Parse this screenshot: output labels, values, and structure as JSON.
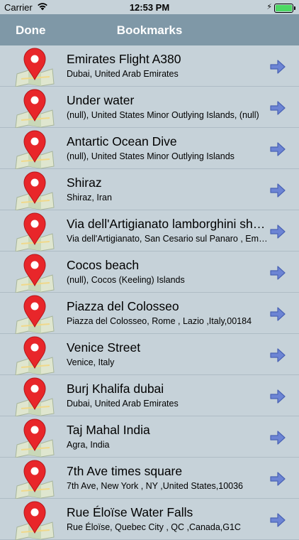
{
  "status_bar": {
    "carrier": "Carrier",
    "time": "12:53 PM",
    "wifi_icon": "wifi-icon",
    "battery_icon": "battery-icon",
    "charging_icon": "charging-bolt-icon"
  },
  "nav": {
    "done_label": "Done",
    "title": "Bookmarks"
  },
  "colors": {
    "nav_bar": "#7f98a7",
    "background": "#c6d2d9",
    "pin": "#e8262a",
    "arrow": "#6c84d4"
  },
  "bookmarks": [
    {
      "name": "Emirates Flight A380",
      "address": "Dubai, United Arab Emirates"
    },
    {
      "name": "Under water",
      "address": "(null), United States Minor Outlying Islands, (null)"
    },
    {
      "name": "Antartic Ocean Dive",
      "address": "(null), United States Minor Outlying Islands"
    },
    {
      "name": "Shiraz",
      "address": "Shiraz, Iran"
    },
    {
      "name": "Via dell'Artigianato lamborghini showroom",
      "address": "Via dell'Artigianato, San Cesario sul Panaro , Emilia-Romagna"
    },
    {
      "name": "Cocos beach",
      "address": "(null), Cocos (Keeling) Islands"
    },
    {
      "name": "Piazza del Colosseo",
      "address": "Piazza del Colosseo, Rome , Lazio ,Italy,00184"
    },
    {
      "name": "Venice Street",
      "address": "Venice, Italy"
    },
    {
      "name": "Burj Khalifa dubai",
      "address": "Dubai, United Arab Emirates"
    },
    {
      "name": "Taj Mahal India",
      "address": "Agra, India"
    },
    {
      "name": "7th Ave times square",
      "address": "7th Ave, New York , NY ,United States,10036"
    },
    {
      "name": "Rue Éloïse Water Falls",
      "address": "Rue Éloïse, Quebec City , QC ,Canada,G1C"
    }
  ]
}
